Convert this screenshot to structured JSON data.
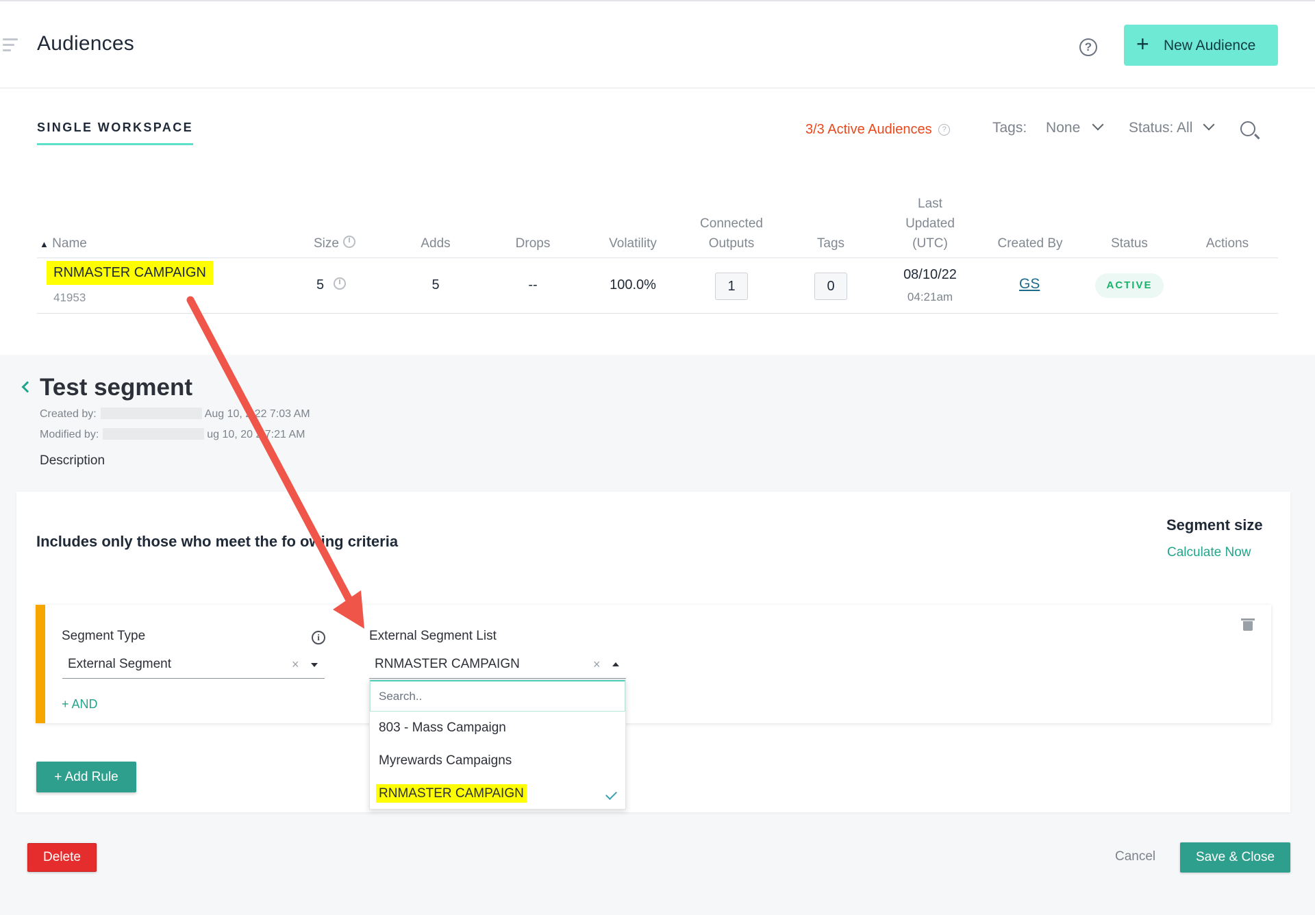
{
  "header": {
    "title": "Audiences",
    "new_audience_label": "New Audience"
  },
  "workspace": {
    "tab_label": "SINGLE WORKSPACE",
    "active_count": "3/3",
    "active_label": "Active Audiences",
    "tags_label": "Tags:",
    "tags_value": "None",
    "status_label": "Status: All"
  },
  "table": {
    "columns": {
      "name": "Name",
      "size": "Size",
      "adds": "Adds",
      "drops": "Drops",
      "volatility": "Volatility",
      "connected_outputs": [
        "Connected",
        "Outputs"
      ],
      "tags": "Tags",
      "last_updated": [
        "Last",
        "Updated",
        "(UTC)"
      ],
      "created_by": "Created By",
      "status": "Status",
      "actions": "Actions"
    },
    "rows": [
      {
        "name": "RNMASTER CAMPAIGN",
        "id": "41953",
        "size": "5",
        "adds": "5",
        "drops": "--",
        "volatility": "100.0%",
        "connected_outputs": "1",
        "tags": "0",
        "date": "08/10/22",
        "time": "04:21am",
        "created_by": "GS",
        "status": "ACTIVE"
      }
    ]
  },
  "segment": {
    "title": "Test segment",
    "created_label": "Created by:",
    "created_visible": "Aug 10, 2 22 7:03 AM",
    "modified_label": "Modified by:",
    "modified_visible": "ug 10, 20 2 7:21 AM",
    "description_label": "Description",
    "criteria_text": "Includes only those who meet the fo owing criteria",
    "size_title": "Segment size",
    "calculate_label": "Calculate Now",
    "rule": {
      "type_label": "Segment Type",
      "type_value": "External Segment",
      "list_label": "External Segment List",
      "list_value": "RNMASTER CAMPAIGN",
      "and_label": "+ AND",
      "search_placeholder": "Search..",
      "options": [
        "803 - Mass Campaign",
        "Myrewards Campaigns",
        "RNMASTER CAMPAIGN"
      ],
      "selected_option": "RNMASTER CAMPAIGN"
    },
    "add_rule_label": "+ Add Rule",
    "delete_label": "Delete",
    "cancel_label": "Cancel",
    "save_label": "Save & Close"
  },
  "colors": {
    "accent_teal": "#2e9f8c",
    "new_button": "#6ee9d3",
    "highlight": "#ffff00",
    "alert_orange": "#e8481c",
    "rule_bar": "#f7a600",
    "delete_red": "#e62d2d",
    "annotation_arrow": "#f0554a"
  },
  "icons": [
    "menu-icon",
    "help-icon",
    "plus-icon",
    "search-icon",
    "chevron-down-icon",
    "clock-icon",
    "back-chevron-icon",
    "info-icon",
    "clear-icon",
    "caret-icon",
    "trash-icon",
    "check-icon",
    "annotation-arrow"
  ]
}
